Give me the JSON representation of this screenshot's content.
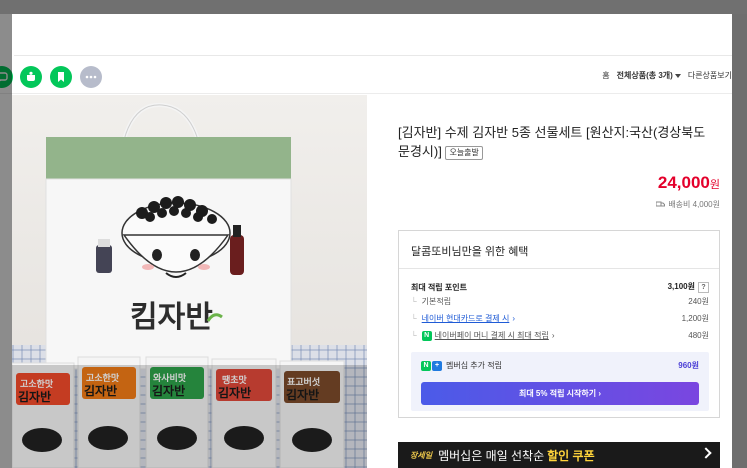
{
  "toolbar": {
    "share_icons": [
      "talk-icon",
      "kakao-icon",
      "bookmark-icon",
      "more-icon"
    ],
    "home_label": "홈",
    "category_label": "전체상품(총 3개)",
    "other_label": "다른상품보기"
  },
  "product": {
    "title": "[김자반] 수제 김자반 5종 선물세트 [원산지:국산(경상북도 문경시)]",
    "badge": "오늘출발",
    "price": "24,000",
    "price_unit": "원",
    "shipping": "배송비 4,000원",
    "image": {
      "box_brand": "킴자반",
      "packs": [
        "고소한맛\n김자반",
        "고소한맛\n김자반",
        "와사비맛\n김자반",
        "땡초맛\n김자반",
        "표고버섯\n김자반"
      ]
    }
  },
  "benefit": {
    "heading": "달콤또비님만을 위한 혜택",
    "max_points_label": "최대 적립 포인트",
    "max_points_value": "3,100원",
    "basic_label": "기본적립",
    "basic_value": "240원",
    "card_label": "네이버 현대카드로 결제 시",
    "card_value": "1,200원",
    "money_label": "네이버페이 머니 결제 시 최대 적립",
    "money_value": "480원",
    "member_label": "멤버십 추가 적립",
    "member_value": "960원",
    "cta_label": "최대 5% 적립 시작하기"
  },
  "banner": {
    "tag": "장세일",
    "text_before": "멤버십은 매일 선착순",
    "highlight": "할인 쿠폰"
  },
  "colors": {
    "price_red": "#e4002b",
    "naver_green": "#03c75a",
    "cta_start": "#4b5be8",
    "cta_end": "#7a46e0"
  }
}
